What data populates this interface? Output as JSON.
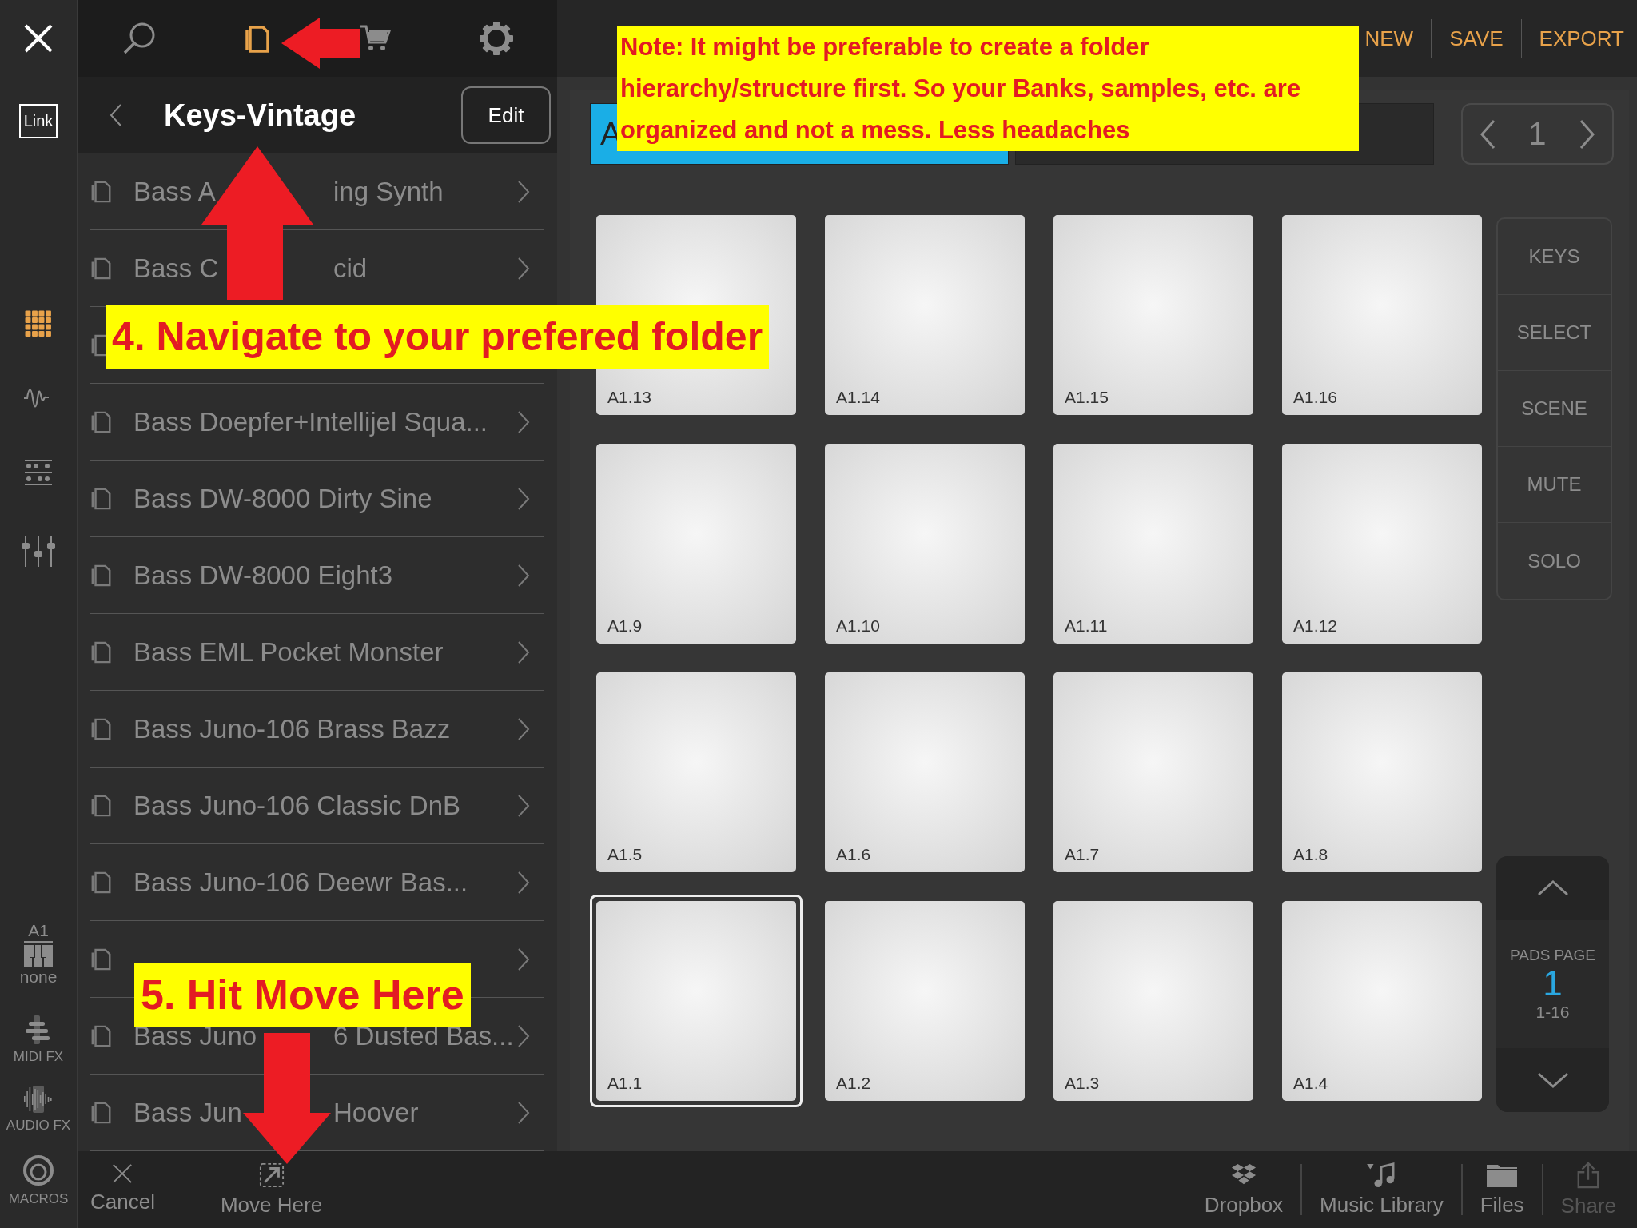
{
  "top_icons": [
    {
      "kind": "search",
      "selected": false
    },
    {
      "kind": "folder",
      "selected": true
    },
    {
      "kind": "cart",
      "selected": false
    },
    {
      "kind": "settings",
      "selected": false
    }
  ],
  "left_rail": {
    "link_label": "Link",
    "tools": [
      {
        "kind": "pads",
        "selected": true
      },
      {
        "kind": "wave",
        "selected": false
      },
      {
        "kind": "sequencer",
        "selected": false
      },
      {
        "kind": "mixer",
        "selected": false
      }
    ],
    "track": {
      "name": "A1",
      "instrument": "none"
    },
    "fx": [
      {
        "kind": "midi",
        "label": "MIDI FX"
      },
      {
        "kind": "audio",
        "label": "AUDIO FX"
      },
      {
        "kind": "macros",
        "label": "MACROS"
      }
    ]
  },
  "browser": {
    "title": "Keys-Vintage",
    "edit_button": "Edit",
    "items": [
      {
        "kind": "folder",
        "parts": [
          "Bass A",
          "ing Synth"
        ]
      },
      {
        "kind": "folder",
        "parts": [
          "Bass C",
          "cid"
        ]
      },
      {
        "kind": "covered"
      },
      {
        "kind": "folder",
        "parts": [
          "Bass Doepfer+Intellijel Squa..."
        ]
      },
      {
        "kind": "folder",
        "parts": [
          "Bass DW-8000 Dirty Sine"
        ]
      },
      {
        "kind": "folder",
        "parts": [
          "Bass DW-8000 Eight3"
        ]
      },
      {
        "kind": "folder",
        "parts": [
          "Bass EML Pocket Monster"
        ]
      },
      {
        "kind": "folder",
        "parts": [
          "Bass Juno-106 Brass Bazz"
        ]
      },
      {
        "kind": "folder",
        "parts": [
          "Bass Juno-106 Classic DnB"
        ]
      },
      {
        "kind": "folder",
        "parts": [
          "Bass Juno-106 Deewr Bas..."
        ]
      },
      {
        "kind": "folder"
      },
      {
        "kind": "folder",
        "parts": [
          "Bass Juno",
          "6 Dusted Bas..."
        ]
      },
      {
        "kind": "folder",
        "parts": [
          "Bass Jun",
          "Hoover"
        ]
      }
    ]
  },
  "top_actions": [
    "NEW",
    "SAVE",
    "EXPORT"
  ],
  "bank_tabs": [
    {
      "label": "A",
      "selected": true
    },
    {
      "selected": false
    }
  ],
  "bank_page": "1",
  "pads": [
    {
      "label": "A1.13",
      "selected": false
    },
    {
      "label": "A1.14",
      "selected": false
    },
    {
      "label": "A1.15",
      "selected": false
    },
    {
      "label": "A1.16",
      "selected": false
    },
    {
      "label": "A1.9",
      "selected": false
    },
    {
      "label": "A1.10",
      "selected": false
    },
    {
      "label": "A1.11",
      "selected": false
    },
    {
      "label": "A1.12",
      "selected": false
    },
    {
      "label": "A1.5",
      "selected": false
    },
    {
      "label": "A1.6",
      "selected": false
    },
    {
      "label": "A1.7",
      "selected": false
    },
    {
      "label": "A1.8",
      "selected": false
    },
    {
      "label": "A1.1",
      "selected": true
    },
    {
      "label": "A1.2",
      "selected": false
    },
    {
      "label": "A1.3",
      "selected": false
    },
    {
      "label": "A1.4",
      "selected": false
    }
  ],
  "side_buttons": [
    "KEYS",
    "SELECT",
    "SCENE",
    "MUTE",
    "SOLO"
  ],
  "pads_page": {
    "label": "PADS PAGE",
    "number": "1",
    "range": "1-16"
  },
  "bottom_left": [
    {
      "kind": "cancel",
      "label": "Cancel"
    },
    {
      "kind": "move",
      "label": "Move Here"
    }
  ],
  "bottom_right": [
    {
      "kind": "dropbox",
      "label": "Dropbox",
      "disabled": false
    },
    {
      "kind": "music",
      "label": "Music Library",
      "disabled": false
    },
    {
      "kind": "files",
      "label": "Files",
      "disabled": false
    },
    {
      "kind": "share",
      "label": "Share",
      "disabled": true
    }
  ],
  "annotations": [
    {
      "kind": "note",
      "text": "Note: It might be preferable to create a folder hierarchy/structure first. So your Banks, samples, etc. are organized and not a mess. Less headaches"
    },
    {
      "kind": "step",
      "text": "4. Navigate to your prefered folder"
    },
    {
      "kind": "step",
      "text": "5. Hit Move Here"
    }
  ]
}
